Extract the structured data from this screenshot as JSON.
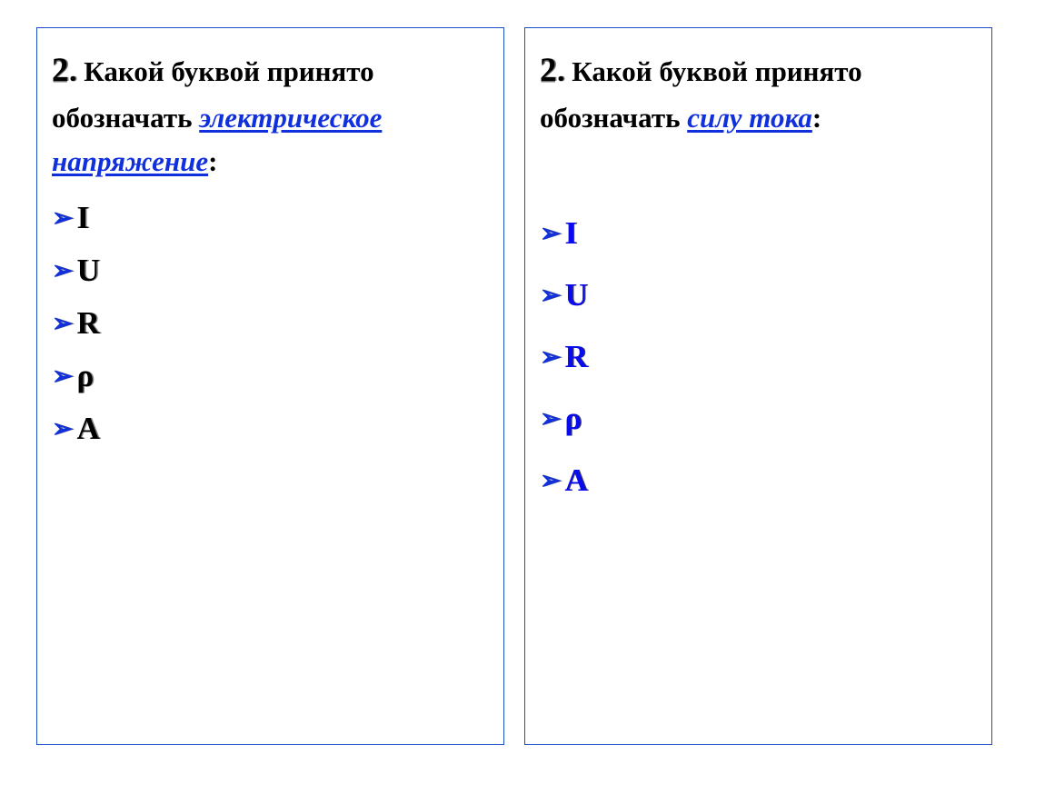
{
  "left": {
    "number": "2",
    "dot": ".",
    "question_prefix": " Какой буквой принято обозначать ",
    "term": "электрическое напряжение",
    "colon": ":",
    "options": [
      "I",
      "U",
      "R",
      "ρ",
      "A"
    ]
  },
  "right": {
    "number": "2",
    "dot": ".",
    "question_prefix": " Какой буквой принято обозначать ",
    "term": "силу тока",
    "colon": ":",
    "options": [
      "I",
      "U",
      "R",
      "ρ",
      "A"
    ]
  },
  "bullet": "➢"
}
